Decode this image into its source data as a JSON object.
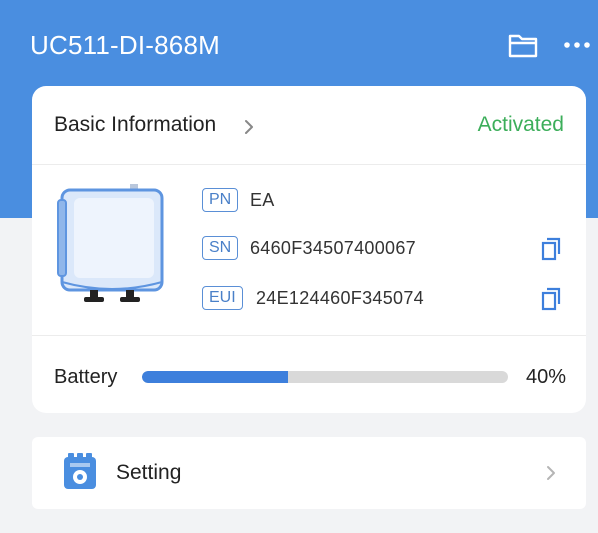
{
  "header": {
    "title": "UC511-DI-868M",
    "background_color": "#4a8ee0",
    "folder_icon": "folder-icon",
    "more_icon": "more-dots-icon"
  },
  "basic_info": {
    "title": "Basic Information",
    "chevron_icon": "chevron-right-icon",
    "status": "Activated",
    "status_color": "#3cae5a"
  },
  "device": {
    "image_icon": "device-controller-icon",
    "fields": [
      {
        "tag": "PN",
        "value": "EA"
      },
      {
        "tag": "SN",
        "value": "6460F34507400067",
        "copy_icon": "copy-icon"
      },
      {
        "tag": "EUI",
        "value": "24E124460F345074",
        "copy_icon": "copy-icon"
      }
    ]
  },
  "battery": {
    "label": "Battery",
    "percent_text": "40%",
    "level_fraction": 0.4,
    "fill_color": "#3d7fdc"
  },
  "setting": {
    "label": "Setting",
    "icon": "settings-gear-icon",
    "chevron_icon": "chevron-right-icon"
  }
}
